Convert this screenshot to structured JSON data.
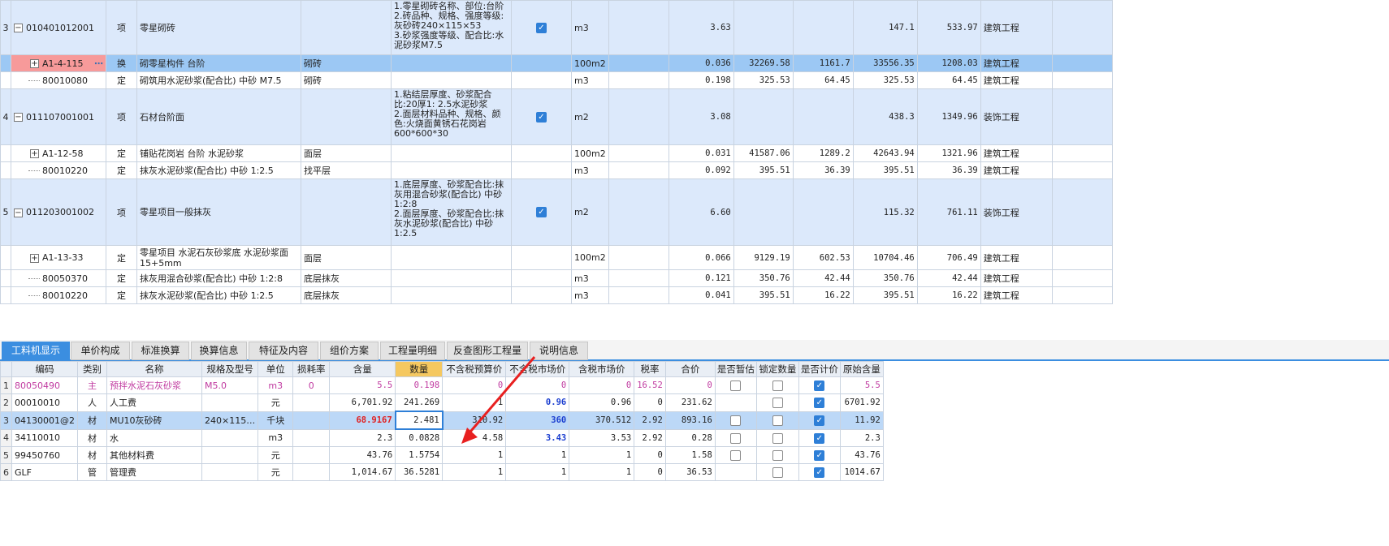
{
  "top": {
    "rows": [
      {
        "kind": "qd",
        "no": "3",
        "code": "010401012001",
        "type": "项",
        "name": "零星砌砖",
        "spec": "",
        "features": "1.零星砌砖名称、部位:台阶\n2.砖品种、规格、强度等级:灰砂砖240×115×53\n3.砂浆强度等级、配合比:水泥砂浆M7.5",
        "checked": true,
        "unit": "m3",
        "qty": "3.63",
        "p1": "",
        "p2": "",
        "p3": "147.1",
        "p4": "533.97",
        "pro": "建筑工程"
      },
      {
        "kind": "sel",
        "no": "",
        "code": "A1-4-115",
        "type": "换",
        "name": "砌零星构件 台阶",
        "spec": "砌砖",
        "features": "",
        "checked": null,
        "unit": "100m2",
        "qty": "0.036",
        "p1": "32269.58",
        "p2": "1161.7",
        "p3": "33556.35",
        "p4": "1208.03",
        "pro": "建筑工程"
      },
      {
        "kind": "leaf",
        "no": "",
        "code": "80010080",
        "type": "定",
        "name": "砌筑用水泥砂浆(配合比) 中砂 M7.5",
        "spec": "砌砖",
        "features": "",
        "checked": null,
        "unit": "m3",
        "qty": "0.198",
        "p1": "325.53",
        "p2": "64.45",
        "p3": "325.53",
        "p4": "64.45",
        "pro": "建筑工程"
      },
      {
        "kind": "qd",
        "no": "4",
        "code": "011107001001",
        "type": "项",
        "name": "石材台阶面",
        "spec": "",
        "features": "1.粘结层厚度、砂浆配合比:20厚1: 2.5水泥砂浆\n2.面层材料品种、规格、颜色:火烧面黄锈石花岗岩600*600*30",
        "checked": true,
        "unit": "m2",
        "qty": "3.08",
        "p1": "",
        "p2": "",
        "p3": "438.3",
        "p4": "1349.96",
        "pro": "装饰工程"
      },
      {
        "kind": "sub",
        "no": "",
        "code": "A1-12-58",
        "type": "定",
        "name": "铺贴花岗岩 台阶 水泥砂浆",
        "spec": "面层",
        "features": "",
        "checked": null,
        "unit": "100m2",
        "qty": "0.031",
        "p1": "41587.06",
        "p2": "1289.2",
        "p3": "42643.94",
        "p4": "1321.96",
        "pro": "建筑工程"
      },
      {
        "kind": "leaf",
        "no": "",
        "code": "80010220",
        "type": "定",
        "name": "抹灰水泥砂浆(配合比) 中砂 1:2.5",
        "spec": "找平层",
        "features": "",
        "checked": null,
        "unit": "m3",
        "qty": "0.092",
        "p1": "395.51",
        "p2": "36.39",
        "p3": "395.51",
        "p4": "36.39",
        "pro": "建筑工程"
      },
      {
        "kind": "qd",
        "no": "5",
        "code": "011203001002",
        "type": "项",
        "name": "零星项目一般抹灰",
        "spec": "",
        "features": "1.底层厚度、砂浆配合比:抹灰用混合砂浆(配合比) 中砂1:2:8\n2.面层厚度、砂浆配合比:抹灰水泥砂浆(配合比) 中砂1:2.5",
        "checked": true,
        "unit": "m2",
        "qty": "6.60",
        "p1": "",
        "p2": "",
        "p3": "115.32",
        "p4": "761.11",
        "pro": "装饰工程"
      },
      {
        "kind": "sub",
        "no": "",
        "code": "A1-13-33",
        "type": "定",
        "name": "零星项目 水泥石灰砂浆底 水泥砂浆面 15+5mm",
        "spec": "面层",
        "features": "",
        "checked": null,
        "unit": "100m2",
        "qty": "0.066",
        "p1": "9129.19",
        "p2": "602.53",
        "p3": "10704.46",
        "p4": "706.49",
        "pro": "建筑工程"
      },
      {
        "kind": "leaf",
        "no": "",
        "code": "80050370",
        "type": "定",
        "name": "抹灰用混合砂浆(配合比) 中砂 1:2:8",
        "spec": "底层抹灰",
        "features": "",
        "checked": null,
        "unit": "m3",
        "qty": "0.121",
        "p1": "350.76",
        "p2": "42.44",
        "p3": "350.76",
        "p4": "42.44",
        "pro": "建筑工程"
      },
      {
        "kind": "leaf",
        "no": "",
        "code": "80010220",
        "type": "定",
        "name": "抹灰水泥砂浆(配合比) 中砂 1:2.5",
        "spec": "底层抹灰",
        "features": "",
        "checked": null,
        "unit": "m3",
        "qty": "0.041",
        "p1": "395.51",
        "p2": "16.22",
        "p3": "395.51",
        "p4": "16.22",
        "pro": "建筑工程"
      }
    ]
  },
  "tabs": [
    "工料机显示",
    "单价构成",
    "标准换算",
    "换算信息",
    "特征及内容",
    "组价方案",
    "工程量明细",
    "反查图形工程量",
    "说明信息"
  ],
  "active_tab": 0,
  "bottom": {
    "headers": [
      "编码",
      "类别",
      "名称",
      "规格及型号",
      "单位",
      "损耗率",
      "含量",
      "数量",
      "不含税预算价",
      "不含税市场价",
      "含税市场价",
      "税率",
      "合价",
      "是否暂估",
      "锁定数量",
      "是否计价",
      "原始含量"
    ],
    "rows": [
      {
        "no": "1",
        "code": "80050490",
        "cat": "主",
        "name": "预拌水泥石灰砂浆",
        "spec": "M5.0",
        "unit": "m3",
        "loss": "0",
        "content": "5.5",
        "qty": "0.198",
        "p1": "0",
        "p2": "0",
        "p3": "0",
        "tax": "16.52",
        "total": "0",
        "est": false,
        "lock": false,
        "price": true,
        "orig": "5.5",
        "style": "pink"
      },
      {
        "no": "2",
        "code": "00010010",
        "cat": "人",
        "name": "人工费",
        "spec": "",
        "unit": "元",
        "loss": "",
        "content": "6,701.92",
        "qty": "241.269",
        "p1": "1",
        "p2": "0.96",
        "p3": "0.96",
        "tax": "0",
        "total": "231.62",
        "est": null,
        "lock": false,
        "price": true,
        "orig": "6701.92",
        "style": "normal"
      },
      {
        "no": "3",
        "code": "04130001@2",
        "cat": "材",
        "name": "MU10灰砂砖",
        "spec": "240×115…",
        "unit": "千块",
        "loss": "",
        "content": "68.9167",
        "qty": "2.481",
        "p1": "310.92",
        "p2": "360",
        "p3": "370.512",
        "tax": "2.92",
        "total": "893.16",
        "est": false,
        "lock": false,
        "price": true,
        "orig": "11.92",
        "style": "sel"
      },
      {
        "no": "4",
        "code": "34110010",
        "cat": "材",
        "name": "水",
        "spec": "",
        "unit": "m3",
        "loss": "",
        "content": "2.3",
        "qty": "0.0828",
        "p1": "4.58",
        "p2": "3.43",
        "p3": "3.53",
        "tax": "2.92",
        "total": "0.28",
        "est": false,
        "lock": false,
        "price": true,
        "orig": "2.3",
        "style": "normal"
      },
      {
        "no": "5",
        "code": "99450760",
        "cat": "材",
        "name": "其他材料费",
        "spec": "",
        "unit": "元",
        "loss": "",
        "content": "43.76",
        "qty": "1.5754",
        "p1": "1",
        "p2": "1",
        "p3": "1",
        "tax": "0",
        "total": "1.58",
        "est": false,
        "lock": false,
        "price": true,
        "orig": "43.76",
        "style": "normal"
      },
      {
        "no": "6",
        "code": "GLF",
        "cat": "管",
        "name": "管理费",
        "spec": "",
        "unit": "元",
        "loss": "",
        "content": "1,014.67",
        "qty": "36.5281",
        "p1": "1",
        "p2": "1",
        "p3": "1",
        "tax": "0",
        "total": "36.53",
        "est": null,
        "lock": false,
        "price": true,
        "orig": "1014.67",
        "style": "normal"
      }
    ]
  },
  "colors": {
    "accent": "#3b8ee0",
    "qd_row": "#dce9fb",
    "selected_row": "#9cc8f4",
    "arrow": "#e82020"
  }
}
